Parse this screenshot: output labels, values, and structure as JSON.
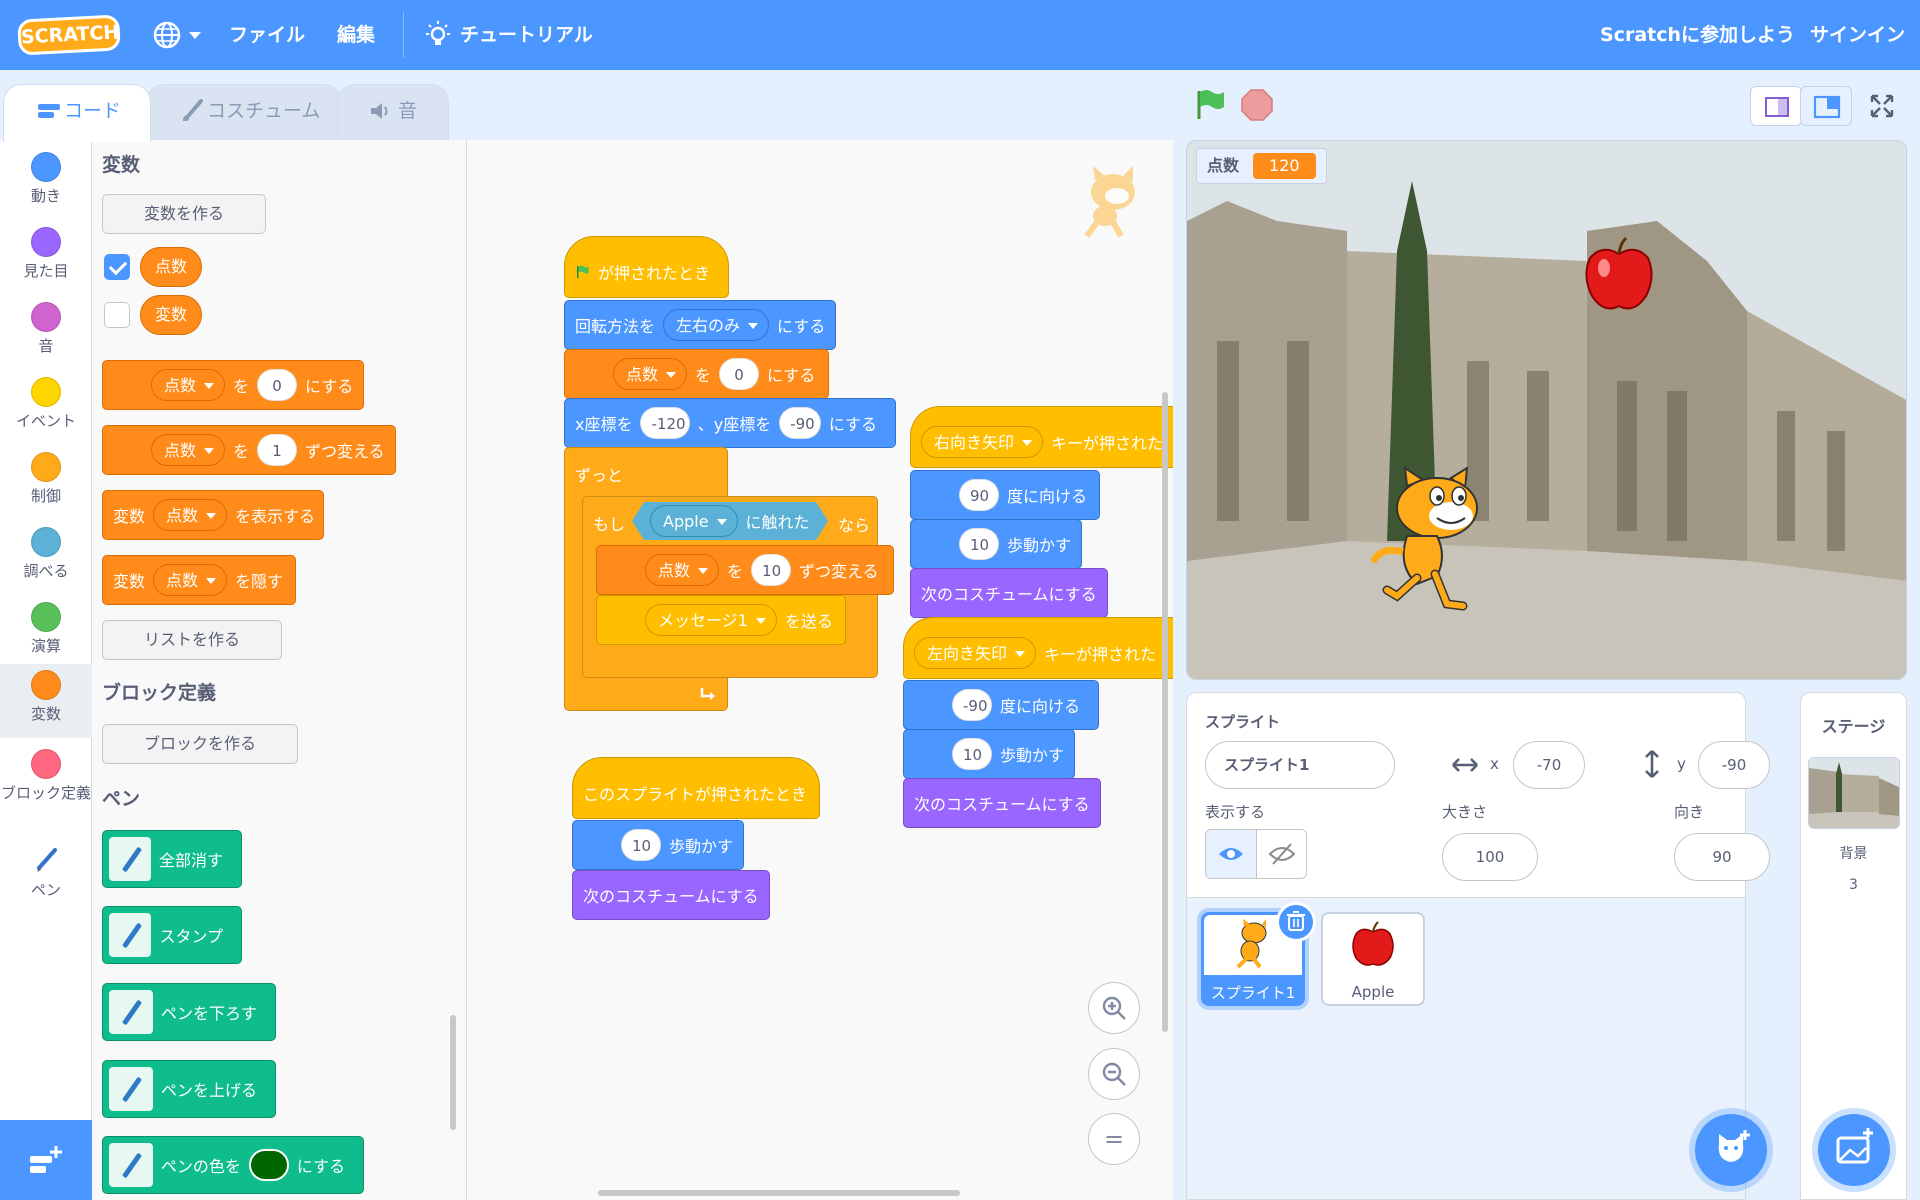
{
  "menu": {
    "logo": "SCRATCH",
    "file": "ファイル",
    "edit": "編集",
    "tutorials": "チュートリアル",
    "join": "Scratchに参加しよう",
    "signin": "サインイン"
  },
  "tabs": {
    "code": "コード",
    "costumes": "コスチューム",
    "sounds": "音"
  },
  "categories": [
    {
      "label": "動き",
      "color": "#4c97ff"
    },
    {
      "label": "見た目",
      "color": "#9966ff"
    },
    {
      "label": "音",
      "color": "#cf63cf"
    },
    {
      "label": "イベント",
      "color": "#ffd500"
    },
    {
      "label": "制御",
      "color": "#ffab19"
    },
    {
      "label": "調べる",
      "color": "#5cb1d6"
    },
    {
      "label": "演算",
      "color": "#59c059"
    },
    {
      "label": "変数",
      "color": "#ff8c1a"
    },
    {
      "label": "ブロック定義",
      "color": "#ff6680"
    },
    {
      "label": "ペン",
      "color": "#0fbd8c"
    }
  ],
  "palette": {
    "variables_heading": "変数",
    "make_variable": "変数を作る",
    "var_score": "点数",
    "var_generic": "変数",
    "set_block": {
      "var": "点数",
      "to": "を",
      "value": "0",
      "suffix": "にする"
    },
    "change_block": {
      "var": "点数",
      "by": "を",
      "value": "1",
      "suffix": "ずつ変える"
    },
    "show_block": {
      "prefix": "変数",
      "var": "点数",
      "suffix": "を表示する"
    },
    "hide_block": {
      "prefix": "変数",
      "var": "点数",
      "suffix": "を隠す"
    },
    "make_list": "リストを作る",
    "myblocks_heading": "ブロック定義",
    "make_block": "ブロックを作る",
    "pen_heading": "ペン",
    "pen_clear": "全部消す",
    "pen_stamp": "スタンプ",
    "pen_down": "ペンを下ろす",
    "pen_up": "ペンを上げる",
    "pen_color": {
      "prefix": "ペンの色を",
      "suffix": "にする"
    }
  },
  "script1": {
    "when_flag": "が押されたとき",
    "rotation": {
      "prefix": "回転方法を",
      "value": "左右のみ",
      "suffix": "にする"
    },
    "set": {
      "var": "点数",
      "to": "を",
      "value": "0",
      "suffix": "にする"
    },
    "goto": {
      "x_label": "x座標を",
      "x": "-120",
      "y_label": "、y座標を",
      "y": "-90",
      "suffix": "にする"
    },
    "forever": "ずっと",
    "if": {
      "prefix": "もし",
      "sprite": "Apple",
      "touching": "に触れた",
      "then": "なら"
    },
    "change": {
      "var": "点数",
      "by": "を",
      "value": "10",
      "suffix": "ずつ変える"
    },
    "broadcast": {
      "message": "メッセージ1",
      "suffix": "を送る"
    }
  },
  "script2": {
    "hat": "このスプライトが押されたとき",
    "move": {
      "value": "10",
      "suffix": "歩動かす"
    },
    "costume": "次のコスチュームにする"
  },
  "script3": {
    "hat": {
      "key": "右向き矢印",
      "suffix": "キーが押された"
    },
    "point": {
      "value": "90",
      "suffix": "度に向ける"
    },
    "move": {
      "value": "10",
      "suffix": "歩動かす"
    },
    "costume": "次のコスチュームにする"
  },
  "script4": {
    "hat": {
      "key": "左向き矢印",
      "suffix": "キーが押された"
    },
    "point": {
      "value": "-90",
      "suffix": "度に向ける"
    },
    "move": {
      "value": "10",
      "suffix": "歩動かす"
    },
    "costume": "次のコスチュームにする"
  },
  "zoom": {
    "in": "+",
    "out": "−",
    "reset": "="
  },
  "stage": {
    "monitor_label": "点数",
    "monitor_value": "120"
  },
  "sprite_info": {
    "sprite_label": "スプライト",
    "name": "スプライト1",
    "x_label": "x",
    "x": "-70",
    "y_label": "y",
    "y": "-90",
    "show_label": "表示する",
    "size_label": "大きさ",
    "size": "100",
    "direction_label": "向き",
    "direction": "90"
  },
  "sprites": [
    {
      "name": "スプライト1",
      "selected": true
    },
    {
      "name": "Apple",
      "selected": false
    }
  ],
  "stage_pane": {
    "title": "ステージ",
    "backdrop_label": "背景",
    "backdrop_count": "3"
  },
  "colors": {
    "menubar": "#4c97ff",
    "variables": "#ff8c1a",
    "motion": "#4c97ff",
    "events": "#ffbf00",
    "control": "#ffab19",
    "looks": "#9966ff",
    "sensing": "#5cb1d6",
    "pen": "#0fbd8c"
  }
}
